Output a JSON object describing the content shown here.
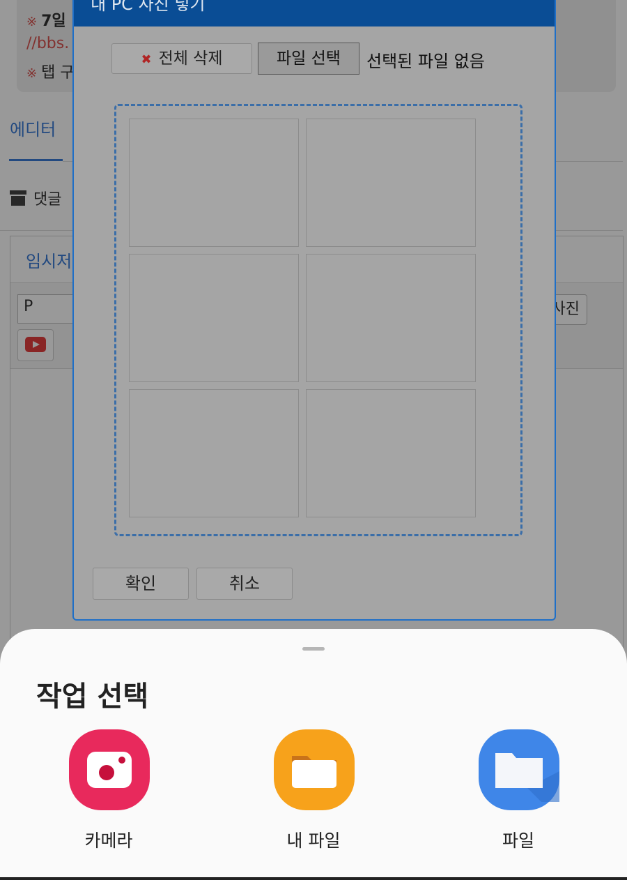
{
  "background": {
    "notice_line1_day": "7일",
    "notice_line2_link": "//bbs.",
    "notice_line3": "탭 구",
    "notice_mark": "※",
    "tab_editor": "에디터",
    "archive_label": "댓글",
    "editor_tab": "임시저",
    "format_value": "P",
    "photo_button_text": "사진"
  },
  "dialog": {
    "title": "내 PC 사진 넣기",
    "delete_all": "전체 삭제",
    "choose_file": "파일 선택",
    "no_file": "선택된 파일 없음",
    "confirm": "확인",
    "cancel": "취소",
    "slot_count": 6
  },
  "sheet": {
    "title": "작업 선택",
    "apps": [
      {
        "label": "카메라",
        "icon": "camera-icon",
        "color": "#e8295c"
      },
      {
        "label": "내 파일",
        "icon": "folder-icon",
        "color": "#f7a21b"
      },
      {
        "label": "파일",
        "icon": "files-icon",
        "color": "#3f86e8"
      }
    ]
  },
  "colors": {
    "accent": "#3a7bd5",
    "dialog_title_bg": "#0a4d95",
    "notice_red": "#d9534f"
  }
}
